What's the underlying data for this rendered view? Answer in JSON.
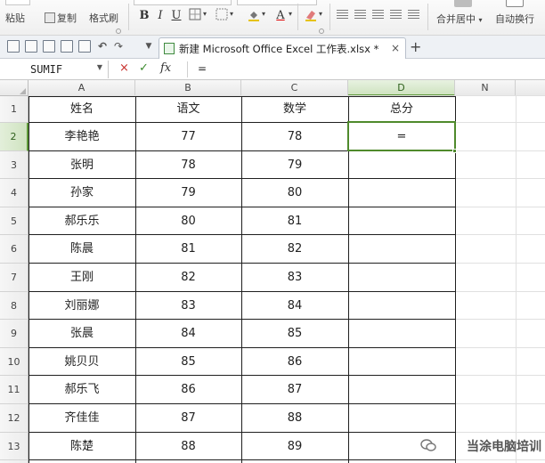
{
  "ribbon": {
    "paste_label": "粘贴",
    "copy_label": "复制",
    "format_painter_label": "格式刷",
    "bold": "B",
    "italic": "I",
    "underline": "U",
    "font_color_glyph": "A",
    "merge_center_label": "合并居中",
    "wrap_text_label": "自动换行",
    "dropdown_glyph": "▾"
  },
  "quick_access": {
    "undo_glyph": "↶",
    "redo_glyph": "↷",
    "more_glyph": "▼"
  },
  "tab": {
    "title": "新建 Microsoft Office Excel 工作表.xlsx *",
    "close_glyph": "×",
    "new_tab_glyph": "+"
  },
  "formula_bar": {
    "name_box": "SUMIF",
    "name_box_arrow": "▼",
    "cancel_glyph": "×",
    "enter_glyph": "✓",
    "fx_label": "fx",
    "formula": "="
  },
  "sheet": {
    "columns": [
      "A",
      "B",
      "C",
      "D",
      "N"
    ],
    "row_numbers": [
      "1",
      "2",
      "3",
      "4",
      "5",
      "6",
      "7",
      "8",
      "9",
      "10",
      "11",
      "12",
      "13"
    ],
    "headers": [
      "姓名",
      "语文",
      "数学",
      "总分"
    ],
    "rows": [
      {
        "name": "李艳艳",
        "chinese": "77",
        "math": "78",
        "total": "="
      },
      {
        "name": "张明",
        "chinese": "78",
        "math": "79",
        "total": ""
      },
      {
        "name": "孙家",
        "chinese": "79",
        "math": "80",
        "total": ""
      },
      {
        "name": "郝乐乐",
        "chinese": "80",
        "math": "81",
        "total": ""
      },
      {
        "name": "陈晨",
        "chinese": "81",
        "math": "82",
        "total": ""
      },
      {
        "name": "王刚",
        "chinese": "82",
        "math": "83",
        "total": ""
      },
      {
        "name": "刘丽娜",
        "chinese": "83",
        "math": "84",
        "total": ""
      },
      {
        "name": "张晨",
        "chinese": "84",
        "math": "85",
        "total": ""
      },
      {
        "name": "姚贝贝",
        "chinese": "85",
        "math": "86",
        "total": ""
      },
      {
        "name": "郝乐飞",
        "chinese": "86",
        "math": "87",
        "total": ""
      },
      {
        "name": "齐佳佳",
        "chinese": "87",
        "math": "88",
        "total": ""
      },
      {
        "name": "陈楚",
        "chinese": "88",
        "math": "89",
        "total": ""
      }
    ],
    "active_cell": "D2"
  },
  "watermark": {
    "text": "当涂电脑培训"
  },
  "colors": {
    "selection": "#4f8a2c",
    "header_bg": "#ececec",
    "table_border": "#1f1f1f"
  }
}
